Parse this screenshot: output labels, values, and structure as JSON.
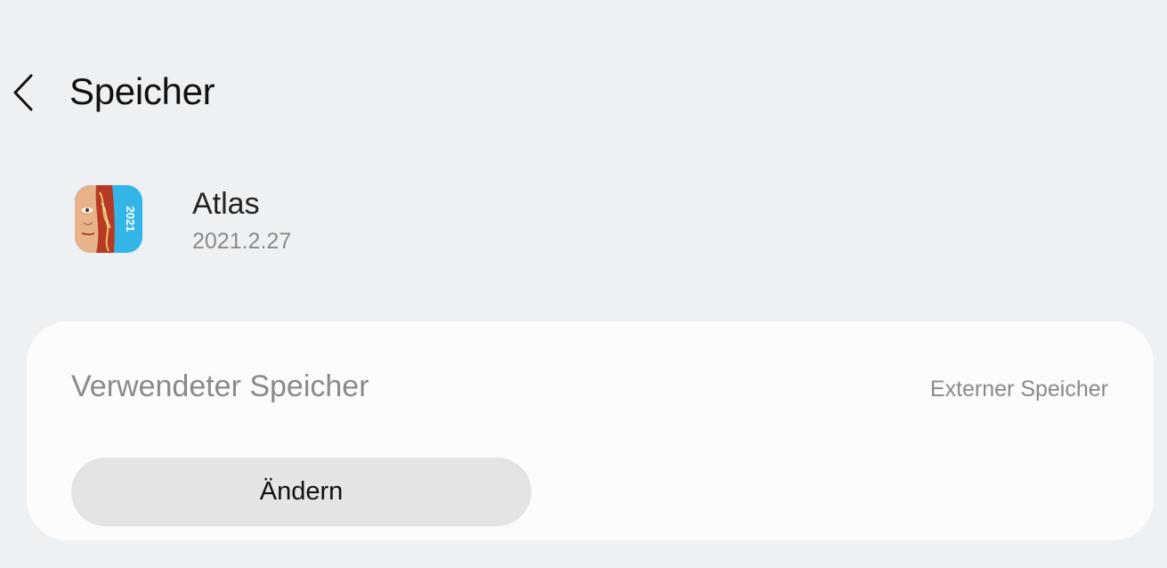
{
  "header": {
    "back_icon": "chevron-left-icon",
    "title": "Speicher"
  },
  "app": {
    "icon": "atlas-app-icon",
    "icon_badge": "2021",
    "name": "Atlas",
    "version": "2021.2.27"
  },
  "storage": {
    "used_label": "Verwendeter Speicher",
    "used_value": "Externer Speicher",
    "change_button": "Ändern"
  },
  "colors": {
    "background": "#eef1f4",
    "card": "#fcfcfc",
    "button": "#e4e4e4",
    "icon_blue": "#33b5e8"
  }
}
